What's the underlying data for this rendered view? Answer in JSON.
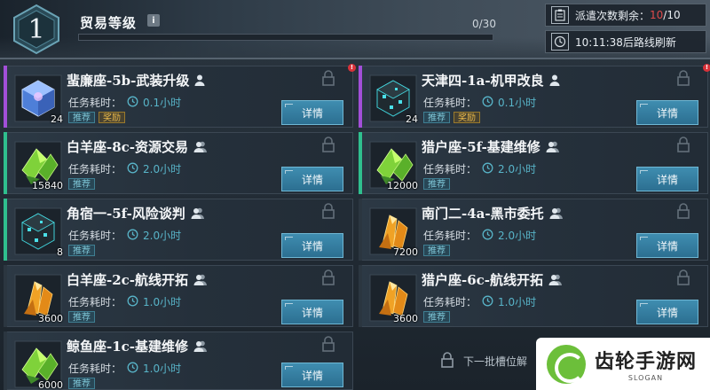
{
  "header": {
    "level": "1",
    "title": "贸易等级",
    "info_icon": "i",
    "progress_text": "0/30",
    "progress_fraction": 0.0,
    "dispatch_label": "派遣次数剩余：",
    "dispatch_current": "10",
    "dispatch_total": "/10",
    "refresh_text": "10:11:38后路线刷新"
  },
  "common": {
    "time_label": "任务耗时：",
    "detail_label": "详情",
    "tag_recommend": "推荐",
    "tag_reward": "奖励"
  },
  "missions": [
    {
      "title": "蜚廉座-5b-武装升级",
      "time": "0.1小时",
      "qty": "24",
      "item": "blue-cube",
      "accent": "#a24fd8",
      "reward": true,
      "alert": true,
      "pilot": "single"
    },
    {
      "title": "天津四-1a-机甲改良",
      "time": "0.1小时",
      "qty": "24",
      "item": "dark-cube",
      "accent": "#a24fd8",
      "reward": true,
      "alert": true,
      "pilot": "single"
    },
    {
      "title": "白羊座-8c-资源交易",
      "time": "2.0小时",
      "qty": "15840",
      "item": "green-crystal",
      "accent": "#2fbf8e",
      "reward": false,
      "alert": false,
      "pilot": "double"
    },
    {
      "title": "猎户座-5f-基建维修",
      "time": "2.0小时",
      "qty": "12000",
      "item": "green-crystal",
      "accent": "#2fbf8e",
      "reward": false,
      "alert": false,
      "pilot": "double"
    },
    {
      "title": "角宿一-5f-风险谈判",
      "time": "2.0小时",
      "qty": "8",
      "item": "dark-cube",
      "accent": "#2fbf8e",
      "reward": false,
      "alert": false,
      "pilot": "double"
    },
    {
      "title": "南门二-4a-黑市委托",
      "time": "2.0小时",
      "qty": "7200",
      "item": "gold-crystal",
      "accent": "#2b3640",
      "reward": false,
      "alert": false,
      "pilot": "double"
    },
    {
      "title": "白羊座-2c-航线开拓",
      "time": "1.0小时",
      "qty": "3600",
      "item": "gold-crystal",
      "accent": "#2b3640",
      "reward": false,
      "alert": false,
      "pilot": "double"
    },
    {
      "title": "猎户座-6c-航线开拓",
      "time": "1.0小时",
      "qty": "3600",
      "item": "gold-crystal",
      "accent": "#2b3640",
      "reward": false,
      "alert": false,
      "pilot": "double"
    },
    {
      "title": "鲸鱼座-1c-基建维修",
      "time": "1.0小时",
      "qty": "6000",
      "item": "green-crystal",
      "accent": "#2b3640",
      "reward": false,
      "alert": false,
      "pilot": "double"
    }
  ],
  "next_slot": {
    "label": "下一批槽位解"
  },
  "watermark": {
    "name": "齿轮手游网",
    "sub": "SLOGAN"
  }
}
